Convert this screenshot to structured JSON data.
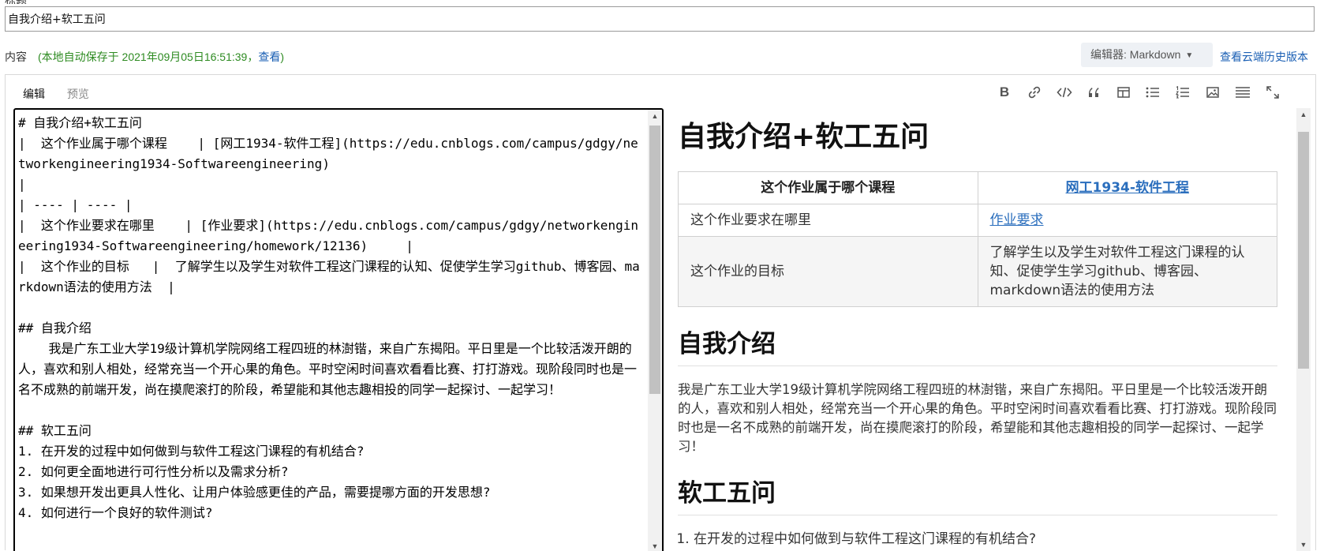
{
  "form": {
    "title_label": "标题",
    "title_value": "自我介绍+软工五问",
    "content_label": "内容",
    "autosave_prefix": "(本地自动保存于 2021年09月05日16:51:39，",
    "autosave_link": "查看",
    "autosave_suffix": ")",
    "editor_select": "编辑器: Markdown",
    "history_link": "查看云端历史版本"
  },
  "tabs": [
    {
      "label": "编辑",
      "active": true
    },
    {
      "label": "预览",
      "active": false
    }
  ],
  "toolbar": [
    {
      "name": "bold-icon",
      "glyph": "B"
    },
    {
      "name": "link-icon"
    },
    {
      "name": "code-icon"
    },
    {
      "name": "quote-icon"
    },
    {
      "name": "table-icon"
    },
    {
      "name": "bullet-list-icon"
    },
    {
      "name": "numbered-list-icon"
    },
    {
      "name": "image-icon"
    },
    {
      "name": "horizontal-rule-icon"
    },
    {
      "name": "fullscreen-icon"
    }
  ],
  "source_lines": [
    "# 自我介绍+软工五问",
    "|  这个作业属于哪个课程    | [网工1934-软件工程](https://edu.cnblogs.com/campus/gdgy/networkengineering1934-Softwareengineering)",
    "|",
    "| ---- | ---- |",
    "|  这个作业要求在哪里    | [作业要求](https://edu.cnblogs.com/campus/gdgy/networkengineering1934-Softwareengineering/homework/12136)     |",
    "|  这个作业的目标   |  了解学生以及学生对软件工程这门课程的认知、促使学生学习github、博客园、markdown语法的使用方法  |",
    "",
    "## 自我介绍",
    "    我是广东工业大学19级计算机学院网络工程四班的林澍锴，来自广东揭阳。平日里是一个比较活泼开朗的人，喜欢和别人相处，经常充当一个开心果的角色。平时空闲时间喜欢看看比赛、打打游戏。现阶段同时也是一名不成熟的前端开发，尚在摸爬滚打的阶段，希望能和其他志趣相投的同学一起探讨、一起学习！",
    "",
    "## 软工五问",
    "1. 在开发的过程中如何做到与软件工程这门课程的有机结合?",
    "2. 如何更全面地进行可行性分析以及需求分析?",
    "3. 如果想开发出更具人性化、让用户体验感更佳的产品，需要提哪方面的开发思想?",
    "4. 如何进行一个良好的软件测试?"
  ],
  "preview": {
    "h1": "自我介绍+软工五问",
    "table": {
      "header": [
        "这个作业属于哪个课程",
        "网工1934-软件工程"
      ],
      "rows": [
        [
          "这个作业要求在哪里",
          "作业要求"
        ],
        [
          "这个作业的目标",
          "了解学生以及学生对软件工程这门课程的认知、促使学生学习github、博客园、markdown语法的使用方法"
        ]
      ]
    },
    "h2_intro": "自我介绍",
    "intro_text": "我是广东工业大学19级计算机学院网络工程四班的林澍锴，来自广东揭阳。平日里是一个比较活泼开朗的人，喜欢和别人相处，经常充当一个开心果的角色。平时空闲时间喜欢看看比赛、打打游戏。现阶段同时也是一名不成熟的前端开发，尚在摸爬滚打的阶段，希望能和其他志趣相投的同学一起探讨、一起学习！",
    "h2_five": "软工五问",
    "questions": [
      "在开发的过程中如何做到与软件工程这门课程的有机结合?"
    ]
  },
  "colors": {
    "autosave": "#2e8b22",
    "link": "#1a5fb4",
    "preview_link": "#2a6ebd"
  }
}
